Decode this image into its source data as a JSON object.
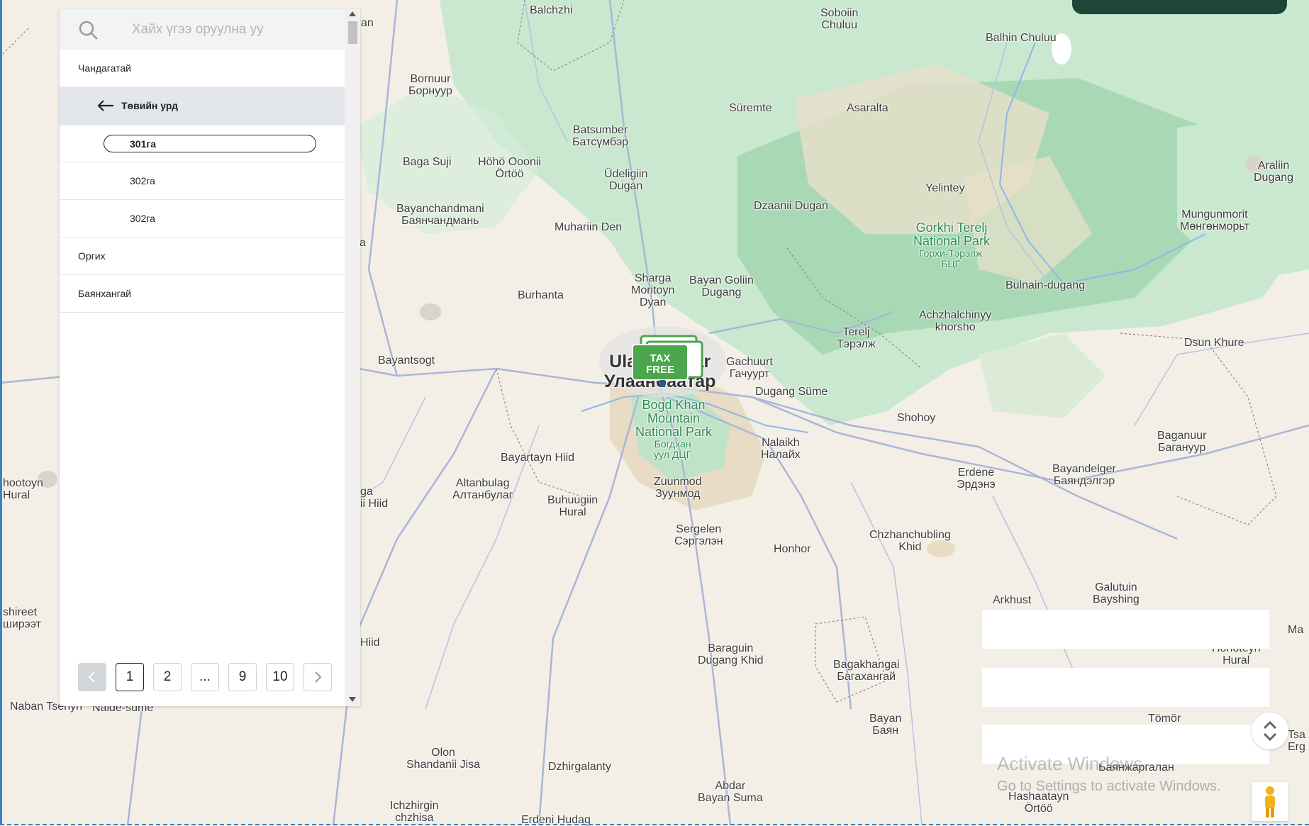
{
  "search": {
    "placeholder": "Хайх үгээ оруулна уу",
    "icon": "search-icon"
  },
  "panel": {
    "items": [
      {
        "label": "Чандагатай",
        "type": "region"
      },
      {
        "label": "Төвийн урд",
        "type": "back"
      },
      {
        "label": "301га",
        "type": "selected"
      },
      {
        "label": "302га",
        "type": "sub"
      },
      {
        "label": "302га",
        "type": "sub"
      },
      {
        "label": "Оргих",
        "type": "region"
      },
      {
        "label": "Баянхангай",
        "type": "region"
      }
    ]
  },
  "pagination": {
    "prev_icon": "chevron-left-icon",
    "pages": [
      "1",
      "2",
      "...",
      "9",
      "10"
    ],
    "current": "1",
    "next_icon": "chevron-right-icon"
  },
  "marker": {
    "line1": "TAX",
    "line2": "FREE"
  },
  "map": {
    "places": [
      {
        "name": "Balchzhi"
      },
      {
        "name": "Soboiin\nChuluu"
      },
      {
        "name": "Balhin Chuluu"
      },
      {
        "name": "Bornuur\nБорнуур"
      },
      {
        "name": "Süremte"
      },
      {
        "name": "Asaralta"
      },
      {
        "name": "Batsumber\nБатсүмбэр"
      },
      {
        "name": "Baga Suji"
      },
      {
        "name": "Höhö Ooonii\nÖrtöö"
      },
      {
        "name": "Üdeligiin\nDugan"
      },
      {
        "name": "Dzaanii Dugan"
      },
      {
        "name": "Yelintey"
      },
      {
        "name": "Araliin\nDugang"
      },
      {
        "name": "Bayanchandmani\nБаянчандмань"
      },
      {
        "name": "Muhariin Den"
      },
      {
        "name": "Mungunmorit\nМөнгөнморьт"
      },
      {
        "name": "Bulnain-dugang"
      },
      {
        "name": "Sharga\nMoritoyn\nDyan"
      },
      {
        "name": "Bayan Goliin\nDugang"
      },
      {
        "name": "Burhanta"
      },
      {
        "name": "Achzhalchinyy\nkhorsho"
      },
      {
        "name": "Terelj\nТэрэлж"
      },
      {
        "name": "Dsun Khure"
      },
      {
        "name": "Bayantsogt"
      },
      {
        "name": "Gachuurt\nГачуурт"
      },
      {
        "name": "Dugang Süme"
      },
      {
        "name": "Shohoy"
      },
      {
        "name": "Bayartayn Hiid"
      },
      {
        "name": "Nalaikh\nНалайх"
      },
      {
        "name": "Baganuur\nБагануур"
      },
      {
        "name": "Altanbulag\nАлтанбулаг"
      },
      {
        "name": "Buhuugiin\nHural"
      },
      {
        "name": "Zuunmod\nЗуунмод"
      },
      {
        "name": "Erdene\nЭрдэнэ"
      },
      {
        "name": "Bayandelger\nБаяндэлгэр"
      },
      {
        "name": "Sergelen\nСэргэлэн"
      },
      {
        "name": "Honhor"
      },
      {
        "name": "Chzhanchubling\nKhid"
      },
      {
        "name": "Arkhust"
      },
      {
        "name": "Galutuin\nBayshing"
      },
      {
        "name": "Baraguin\nDugang Khid"
      },
      {
        "name": "Bagakhangai\nБагахангай"
      },
      {
        "name": "Honoteyn\nHural"
      },
      {
        "name": "Bayan\nБаян"
      },
      {
        "name": "Tömör"
      },
      {
        "name": "Olon\nShandanii Jisa"
      },
      {
        "name": "Dzhirgalanty"
      },
      {
        "name": "Abdar\nBayan Suma"
      },
      {
        "name": "Баянжаргалан"
      },
      {
        "name": "Ichzhirgin\nchzhisa"
      },
      {
        "name": "Erdeni Hudag"
      },
      {
        "name": "Hashaatayn\nÖrtöö"
      },
      {
        "name": "Naban Tsenyn"
      },
      {
        "name": "Naide-sume"
      },
      {
        "name": "hootoyn\nHural"
      },
      {
        "name": "shireet\nширээт"
      },
      {
        "name": "an"
      },
      {
        "name": "a"
      },
      {
        "name": "ga\nii Hiid"
      },
      {
        "name": "Hiid"
      },
      {
        "name": "Ma"
      },
      {
        "name": "Tsa\nErg"
      }
    ],
    "city": {
      "name": "Ulaanbaatar\nУлаанбаатар"
    },
    "parks": [
      {
        "name": "Gorkhi Terelj\nNational Park",
        "sub": "Горхи-Тэрэлж\nБЦГ"
      },
      {
        "name": "Bogd Khan\nMountain\nNational Park",
        "sub": "Богдхан\nуул ДЦГ"
      }
    ]
  },
  "watermark": {
    "title": "Activate Windows",
    "subtitle": "Go to Settings to activate Windows."
  },
  "controls": {
    "fullscreen_icon": "fullscreen-icon",
    "pegman_icon": "pegman-icon"
  },
  "colors": {
    "park_green": "#bfe3c7",
    "forest_green": "#9fd6ad",
    "land": "#f3efe6",
    "road": "#a9b6d8",
    "accent": "#1e4638",
    "marker_green": "#4ca64c"
  }
}
